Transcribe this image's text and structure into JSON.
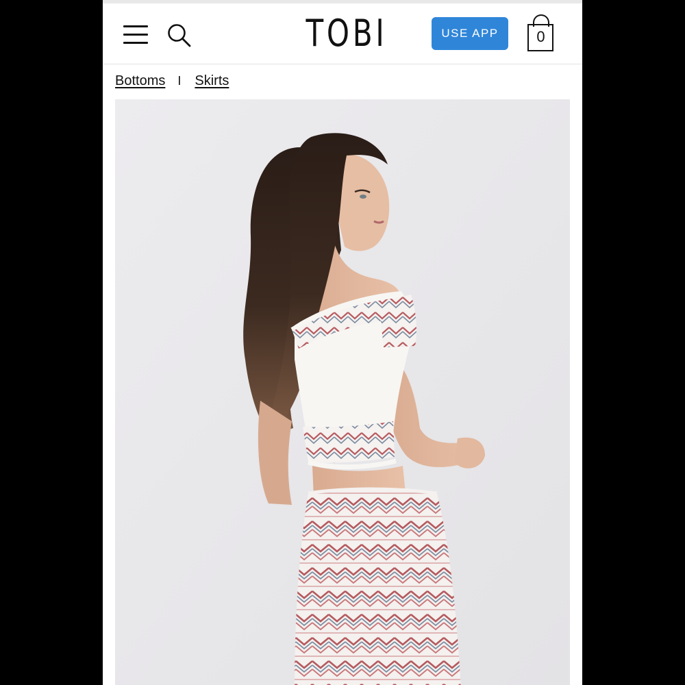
{
  "header": {
    "logo": "TOBI",
    "use_app_label": "USE APP",
    "cart_count": "0"
  },
  "breadcrumb": {
    "items": [
      {
        "label": "Bottoms"
      },
      {
        "label": "Skirts"
      }
    ],
    "separator": "I"
  },
  "product_image": {
    "description_icon": "model-photo",
    "alt": "Model wearing white off-shoulder smocked crop top and matching smocked mini skirt with red and blue zigzag pattern"
  },
  "colors": {
    "accent": "#2f86d9",
    "background": "#ffffff",
    "frame": "#000000",
    "photo_background": "#e9e8ea"
  }
}
